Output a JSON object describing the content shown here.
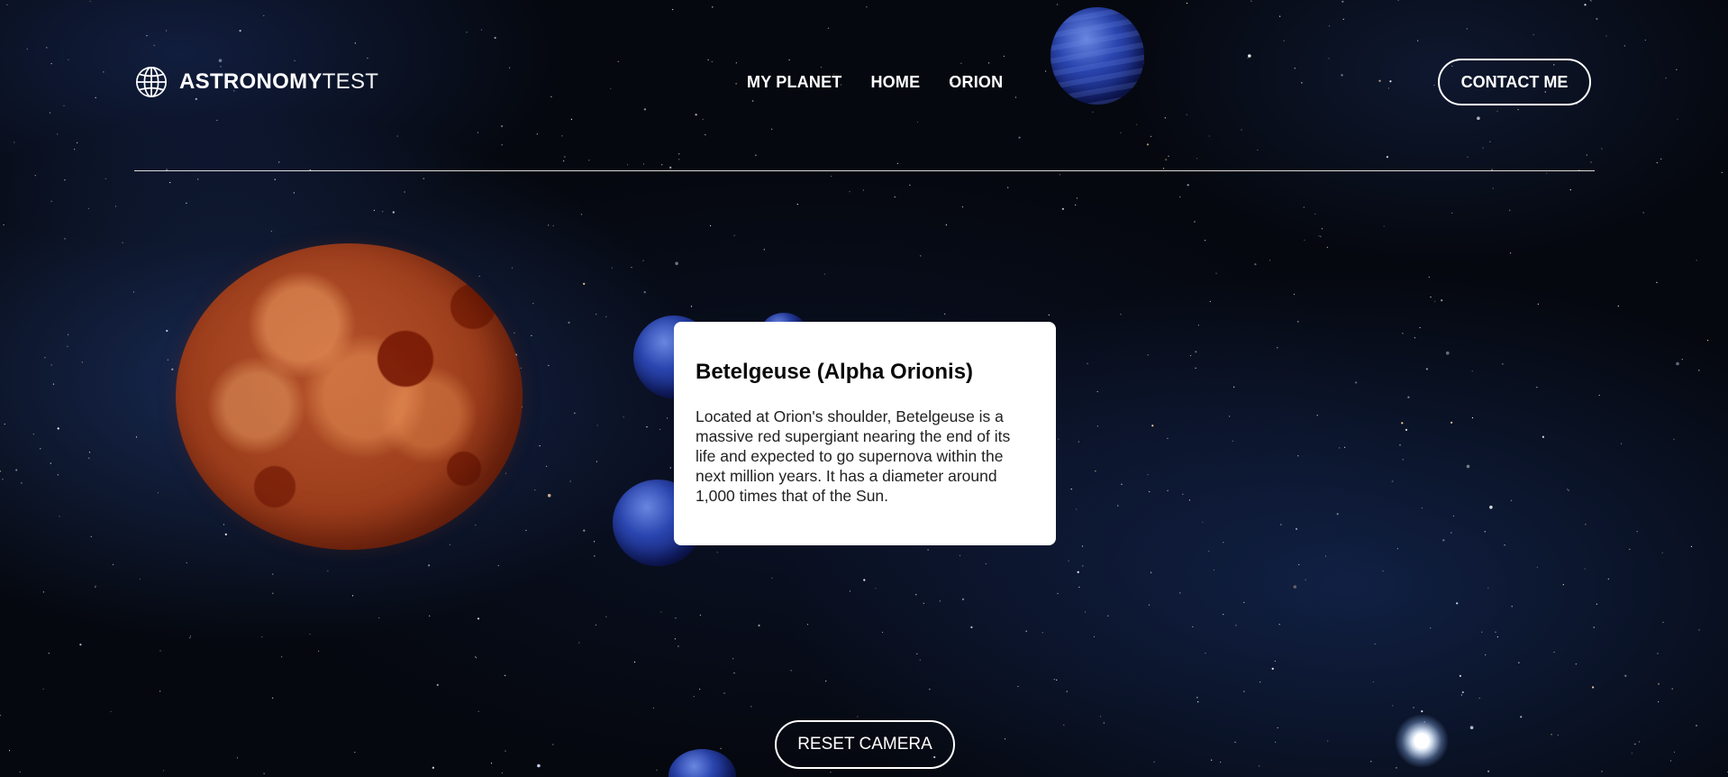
{
  "header": {
    "logo_bold": "ASTRONOMY",
    "logo_light": "TEST",
    "nav": [
      {
        "label": "MY PLANET"
      },
      {
        "label": "HOME"
      },
      {
        "label": "ORION"
      }
    ],
    "contact_label": "CONTACT ME"
  },
  "info_card": {
    "title": "Betelgeuse (Alpha Orionis)",
    "body": "Located at Orion's shoulder, Betelgeuse is a massive red supergiant nearing the end of its life and expected to go supernova within the next million years. It has a diameter around 1,000 times that of the Sun."
  },
  "controls": {
    "reset_label": "RESET CAMERA"
  },
  "colors": {
    "background": "#05080f",
    "text_light": "#ffffff",
    "card_bg": "#ffffff",
    "red_planet": "#a9451f",
    "blue_planet": "#2b46b0"
  },
  "icons": {
    "logo_icon": "globe-icon"
  }
}
